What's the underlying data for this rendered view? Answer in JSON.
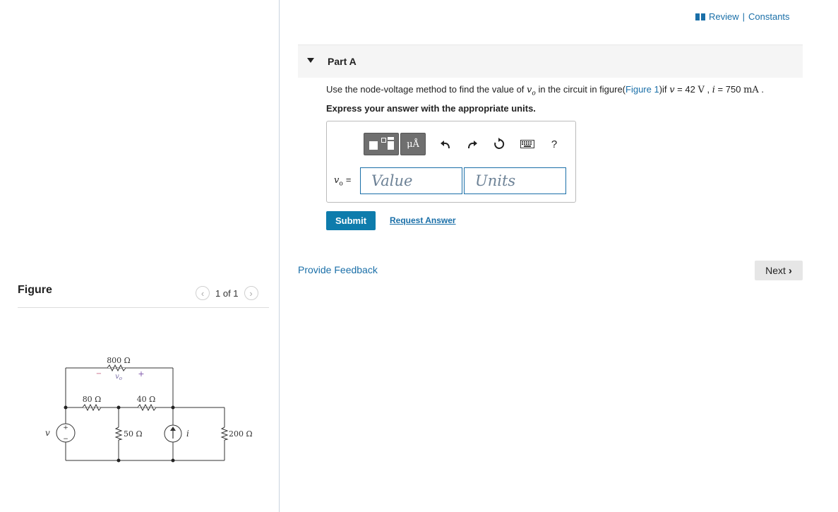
{
  "header": {
    "review_label": "Review",
    "separator": "|",
    "constants_label": "Constants"
  },
  "part": {
    "title": "Part A"
  },
  "question": {
    "prefix": "Use the node-voltage method to find the value of",
    "var_vo": "v",
    "var_vo_sub": "o",
    "middle": "in the circuit in figure(",
    "figure_link": "Figure 1",
    "after_link": ")if",
    "var_v": "v",
    "v_eq": "= 42",
    "v_unit": "V",
    "comma": ",",
    "var_i": "i",
    "i_eq": "= 750",
    "i_unit": "mA",
    "end": "."
  },
  "instruction": "Express your answer with the appropriate units.",
  "answer": {
    "toolbar_units_label": "μÅ",
    "help_label": "?",
    "label_var": "v",
    "label_sub": "o",
    "label_eq": "=",
    "value_placeholder": "Value",
    "units_placeholder": "Units"
  },
  "actions": {
    "submit_label": "Submit",
    "request_label": "Request Answer",
    "feedback_label": "Provide Feedback",
    "next_label": "Next"
  },
  "figure": {
    "title": "Figure",
    "pager": "1 of 1",
    "labels": {
      "r800": "800 Ω",
      "r80": "80 Ω",
      "r40": "40 Ω",
      "r50": "50 Ω",
      "r200": "200 Ω",
      "vo": "v",
      "vo_sub": "o",
      "v_src": "v",
      "i_src": "i",
      "minus": "−",
      "plus": "+"
    }
  },
  "colors": {
    "link": "#1a6fa8",
    "submit_bg": "#0e7cac",
    "toolbar_bg": "#6f6f6f",
    "input_border": "#1a6fa8",
    "circuit_minus": "#c45b7a",
    "circuit_plus": "#7a4fa8"
  }
}
